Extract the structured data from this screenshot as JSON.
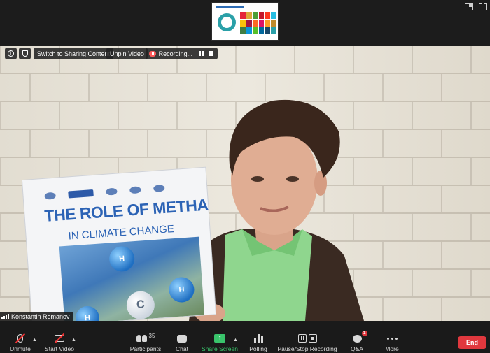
{
  "top": {
    "thumbnail_colors": [
      "#e5243b",
      "#dda63a",
      "#4c9f38",
      "#c5192d",
      "#ff3a21",
      "#26bde2",
      "#fcc30b",
      "#a21942",
      "#fd6925",
      "#dd1367",
      "#fd9d24",
      "#bf8b2e",
      "#3f7e44",
      "#0a97d9",
      "#56c02b",
      "#00689d",
      "#19486a",
      "#2aa0a8"
    ]
  },
  "overlay": {
    "info_icon": "info-icon",
    "security_icon": "shield-icon",
    "switch_label": "Switch to Sharing Content",
    "unpin_label": "Unpin Video",
    "recording_label": "Recording..."
  },
  "video": {
    "book_title": "THE ROLE OF METHANE",
    "book_subtitle": "IN CLIMATE CHANGE",
    "atoms": [
      "H",
      "H",
      "C",
      "H"
    ],
    "participant_name": "Konstantin Romanov"
  },
  "toolbar": {
    "unmute": "Unmute",
    "start_video": "Start Video",
    "participants": "Participants",
    "participants_count": "35",
    "chat": "Chat",
    "share_screen": "Share Screen",
    "polling": "Polling",
    "pause_stop": "Pause/Stop Recording",
    "qa": "Q&A",
    "qa_badge": "1",
    "more": "More",
    "end": "End",
    "accent_green": "#39c46b",
    "end_red": "#e0383e"
  }
}
